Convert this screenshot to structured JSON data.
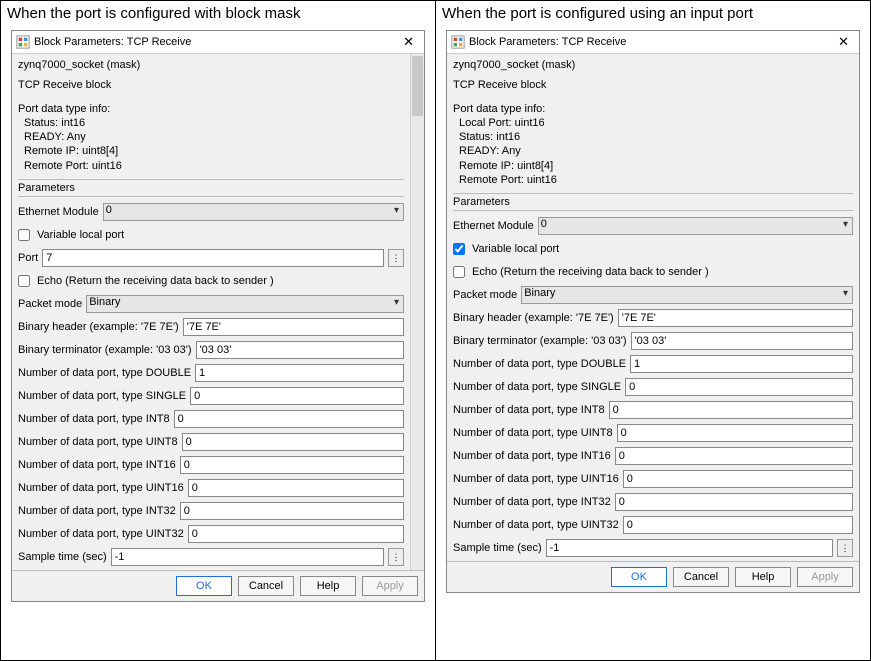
{
  "columns": {
    "left_title": "When the port is configured with block mask",
    "right_title": "When the port is configured using an input port"
  },
  "common": {
    "window_title": "Block Parameters: TCP Receive",
    "mask_name": "zynq7000_socket (mask)",
    "block_desc": "TCP Receive block",
    "info_heading": "Port data type info:",
    "parameters_heading": "Parameters",
    "labels": {
      "ethernet_module": "Ethernet Module",
      "variable_local_port": "Variable local port",
      "port": "Port",
      "echo": "Echo (Return the receiving data back to sender )",
      "packet_mode": "Packet mode",
      "binary_header": "Binary header (example: '7E 7E')",
      "binary_terminator": "Binary terminator (example: '03 03')",
      "num_double": "Number of data port, type DOUBLE",
      "num_single": "Number of data port, type SINGLE",
      "num_int8": "Number of data port, type INT8",
      "num_uint8": "Number of data port, type UINT8",
      "num_int16": "Number of data port, type INT16",
      "num_uint16": "Number of data port, type UINT16",
      "num_int32": "Number of data port, type INT32",
      "num_uint32": "Number of data port, type UINT32",
      "sample_time": "Sample time (sec)"
    },
    "buttons": {
      "ok": "OK",
      "cancel": "Cancel",
      "help": "Help",
      "apply": "Apply"
    }
  },
  "left": {
    "info_lines": [
      "Status: int16",
      "READY: Any",
      "Remote IP: uint8[4]",
      "Remote Port: uint16"
    ],
    "values": {
      "ethernet_module": "0",
      "variable_local_port_checked": false,
      "port": "7",
      "echo_checked": false,
      "packet_mode": "Binary",
      "binary_header": "'7E 7E'",
      "binary_terminator": "'03 03'",
      "num_double": "1",
      "num_single": "0",
      "num_int8": "0",
      "num_uint8": "0",
      "num_int16": "0",
      "num_uint16": "0",
      "num_int32": "0",
      "num_uint32": "0",
      "sample_time": "-1"
    }
  },
  "right": {
    "info_lines": [
      "Local Port: uint16",
      "Status: int16",
      "READY: Any",
      "Remote IP: uint8[4]",
      "Remote Port: uint16"
    ],
    "values": {
      "ethernet_module": "0",
      "variable_local_port_checked": true,
      "echo_checked": false,
      "packet_mode": "Binary",
      "binary_header": "'7E 7E'",
      "binary_terminator": "'03 03'",
      "num_double": "1",
      "num_single": "0",
      "num_int8": "0",
      "num_uint8": "0",
      "num_int16": "0",
      "num_uint16": "0",
      "num_int32": "0",
      "num_uint32": "0",
      "sample_time": "-1"
    }
  }
}
